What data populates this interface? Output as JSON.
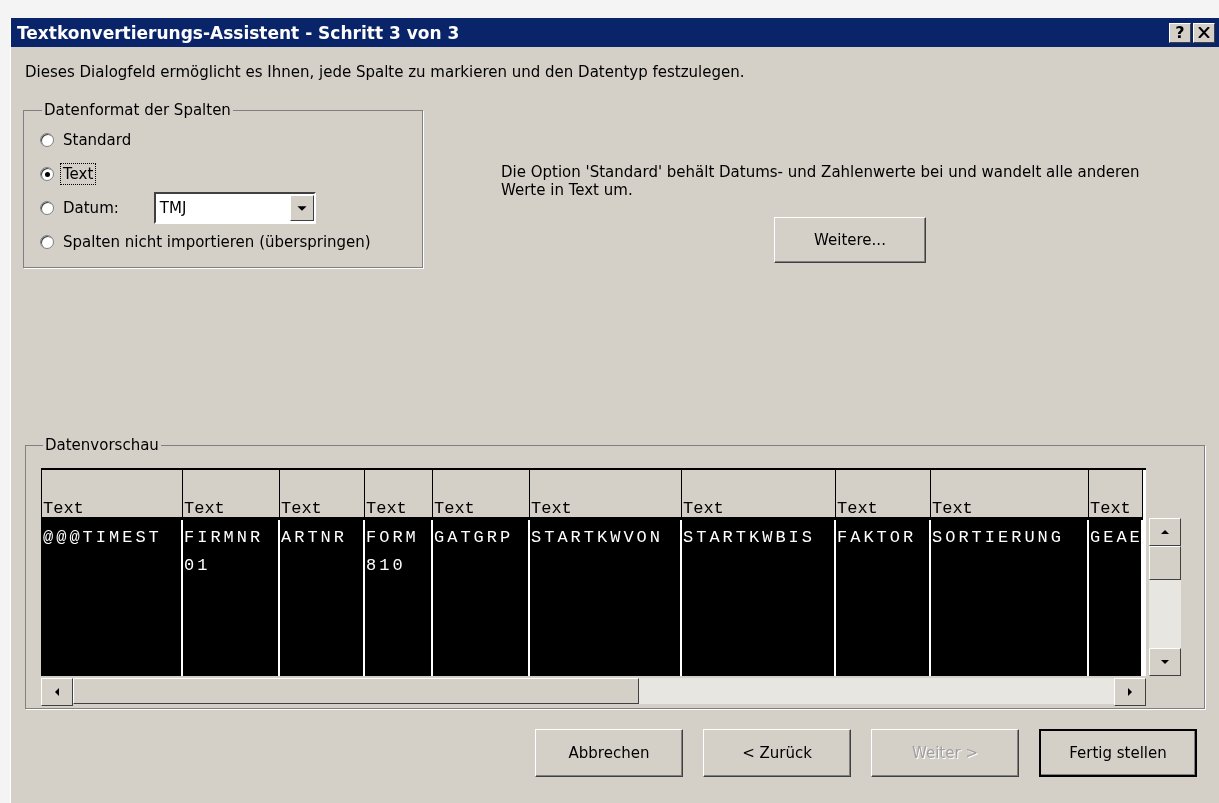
{
  "window": {
    "title": "Textkonvertierungs-Assistent - Schritt 3 von 3",
    "help_button": "?"
  },
  "description": "Dieses Dialogfeld ermöglicht es Ihnen, jede Spalte zu markieren und den Datentyp festzulegen.",
  "format_group": {
    "title": "Datenformat der Spalten",
    "options": [
      {
        "label": "Standard",
        "selected": false,
        "focused": false
      },
      {
        "label": "Text",
        "selected": true,
        "focused": true
      },
      {
        "label": "Datum:",
        "selected": false,
        "focused": false,
        "date_format": "TMJ"
      },
      {
        "label": "Spalten nicht importieren (überspringen)",
        "selected": false,
        "focused": false
      }
    ]
  },
  "info_text": "Die Option 'Standard' behält Datums- und Zahlenwerte bei und wandelt alle anderen Werte in Text um.",
  "more_button": "Weitere...",
  "preview": {
    "title": "Datenvorschau",
    "columns": [
      {
        "type": "Text",
        "selected": true,
        "cells": [
          "@@@TIMEST"
        ]
      },
      {
        "type": "Text",
        "selected": true,
        "cells": [
          "FIRMNR",
          "01"
        ]
      },
      {
        "type": "Text",
        "selected": true,
        "cells": [
          "ARTNR"
        ]
      },
      {
        "type": "Text",
        "selected": true,
        "cells": [
          "FORM",
          "810"
        ]
      },
      {
        "type": "Text",
        "selected": true,
        "cells": [
          "GATGRP"
        ]
      },
      {
        "type": "Text",
        "selected": true,
        "cells": [
          "STARTKWVON"
        ]
      },
      {
        "type": "Text",
        "selected": true,
        "cells": [
          "STARTKWBIS"
        ]
      },
      {
        "type": "Text",
        "selected": true,
        "cells": [
          "FAKTOR"
        ]
      },
      {
        "type": "Text",
        "selected": true,
        "cells": [
          "SORTIERUNG"
        ]
      },
      {
        "type": "Text",
        "selected": true,
        "cells": [
          "GEAE"
        ]
      }
    ]
  },
  "buttons": [
    {
      "label": "Abbrechen",
      "disabled": false,
      "default": false
    },
    {
      "label": "< Zurück",
      "disabled": false,
      "default": false
    },
    {
      "label": "Weiter >",
      "disabled": true,
      "default": false
    },
    {
      "label": "Fertig stellen",
      "disabled": false,
      "default": true
    }
  ]
}
